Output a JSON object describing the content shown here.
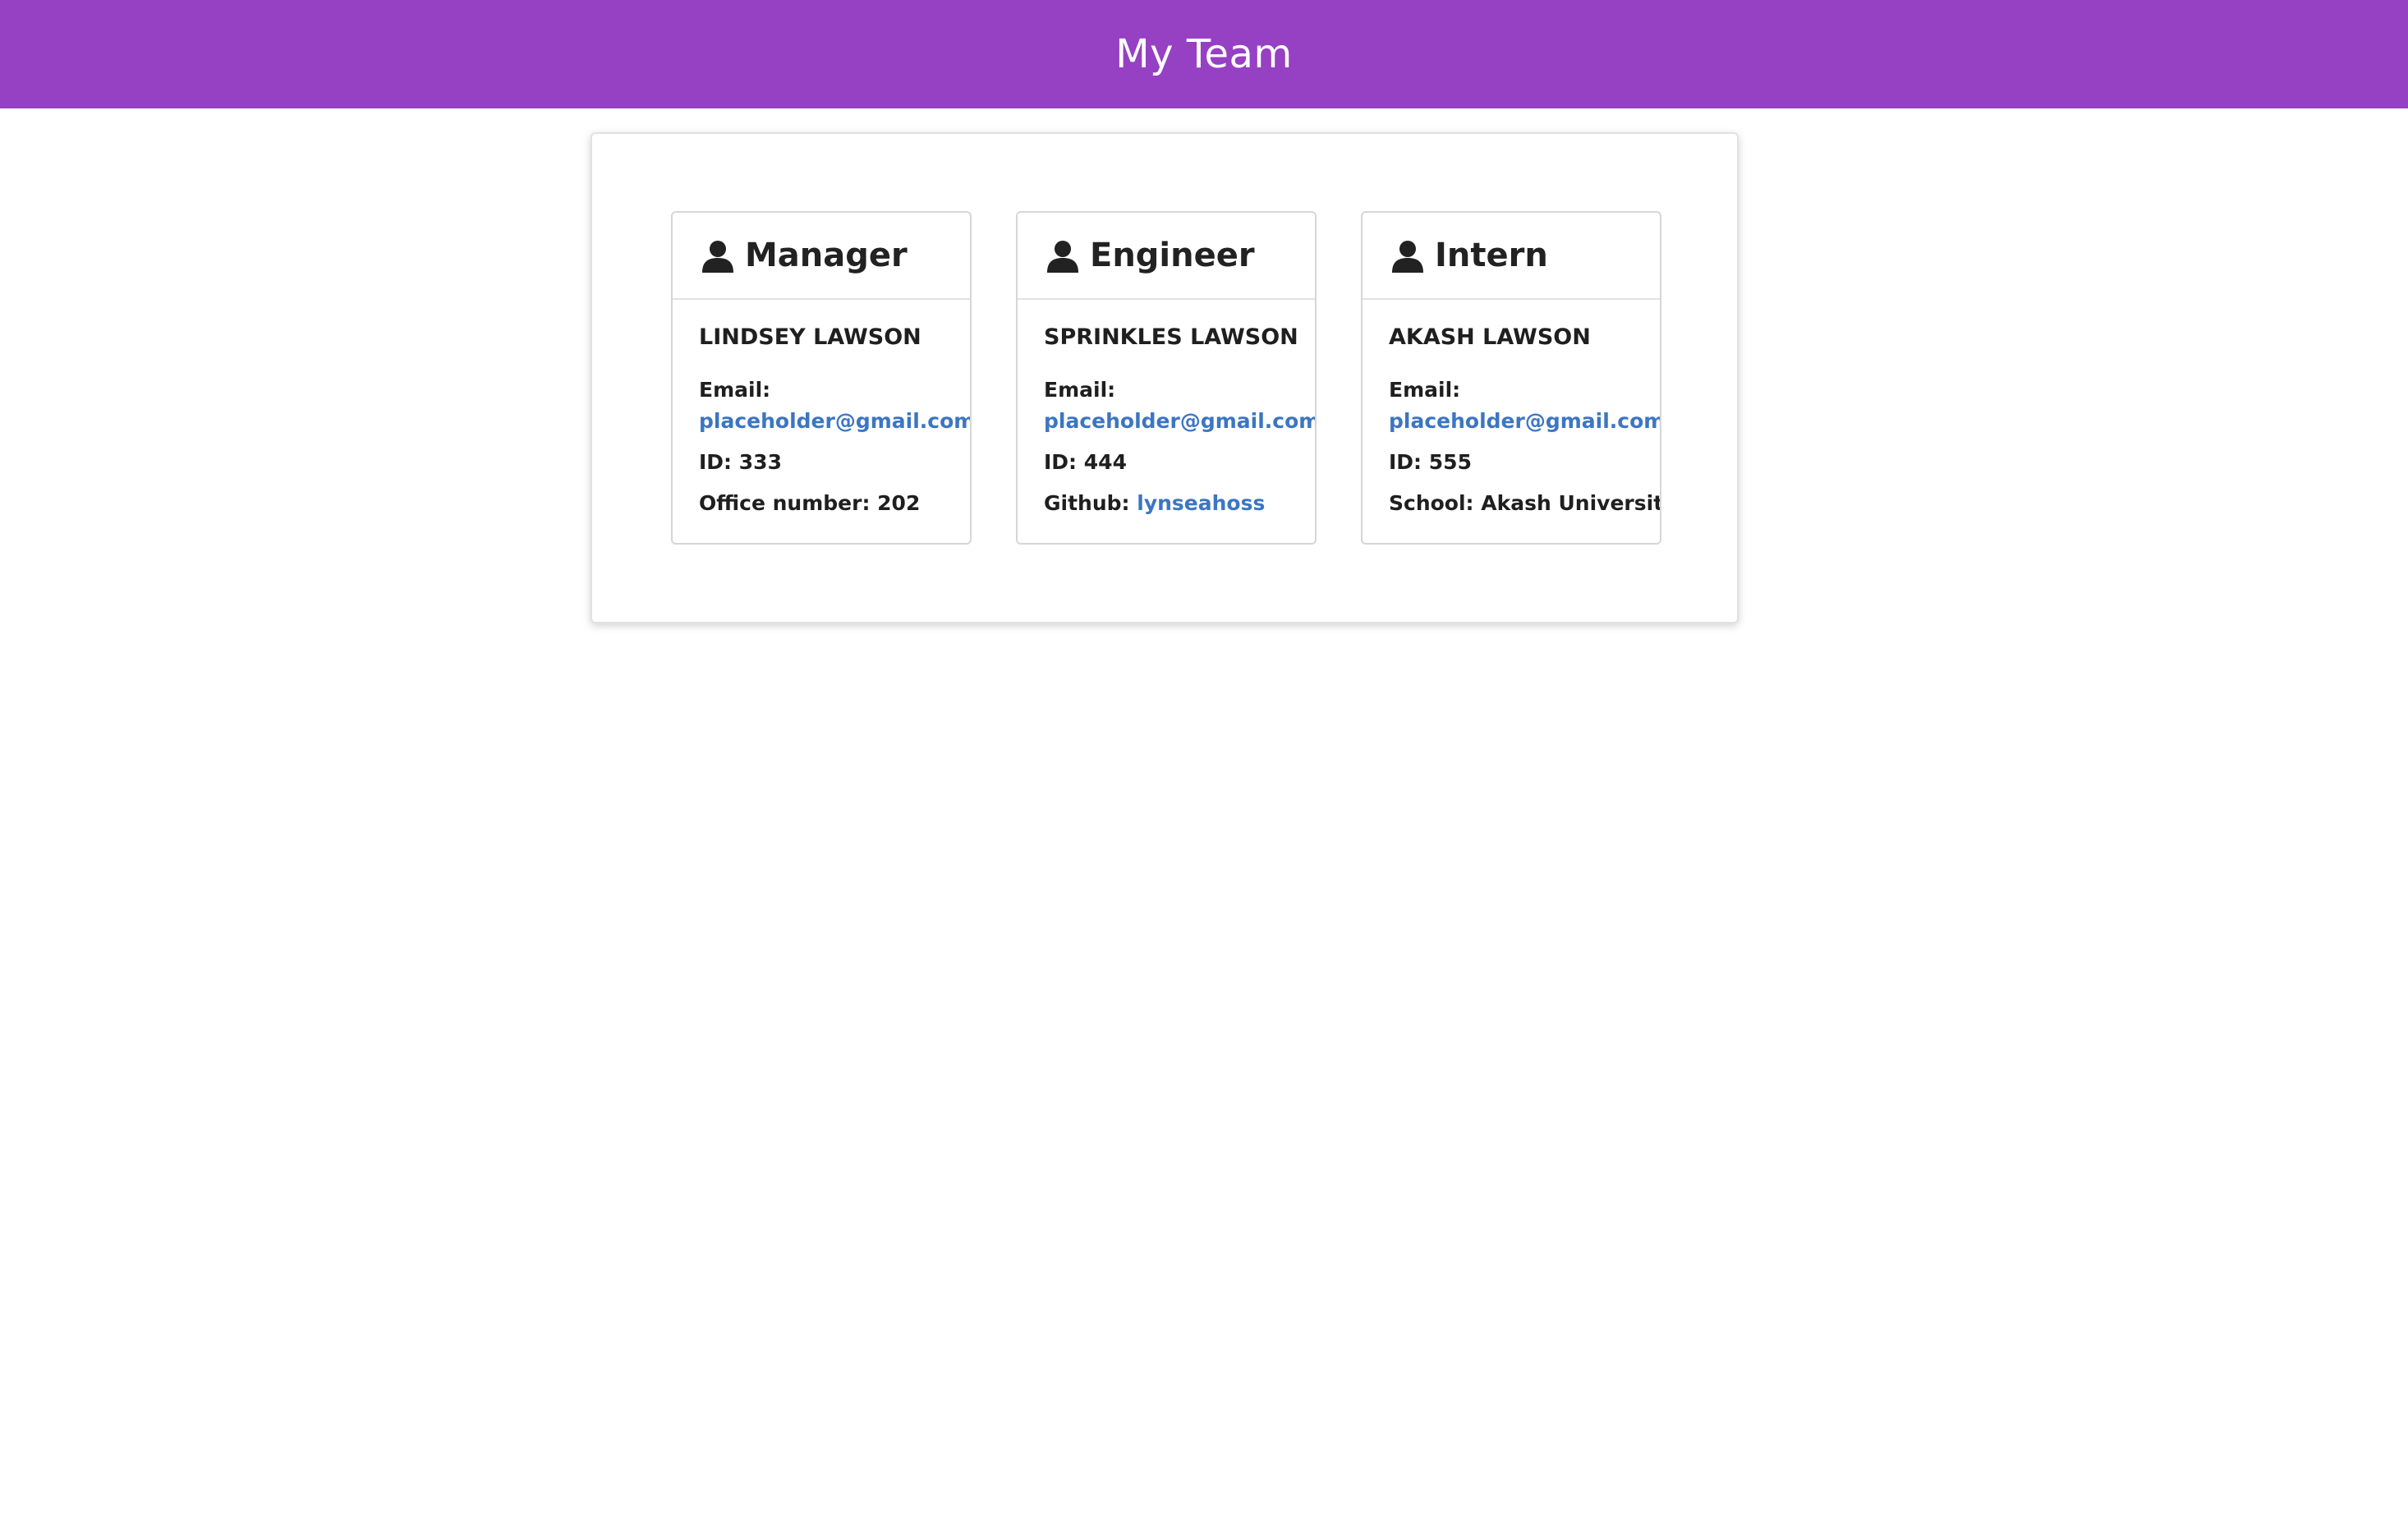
{
  "header": {
    "title": "My Team",
    "background_color": "#9640c4"
  },
  "team": [
    {
      "role": "Manager",
      "icon": "person-icon",
      "name": "LINDSEY LAWSON",
      "email_label": "Email:",
      "email": "placeholder@gmail.com",
      "id_label": "ID:",
      "id": "333",
      "extra_label": "Office number:",
      "extra_value": "202"
    },
    {
      "role": "Engineer",
      "icon": "person-icon",
      "name": "SPRINKLES LAWSON",
      "email_label": "Email:",
      "email": "placeholder@gmail.com",
      "id_label": "ID:",
      "id": "444",
      "extra_label": "Github:",
      "extra_value": "lynseahoss"
    },
    {
      "role": "Intern",
      "icon": "person-icon",
      "name": "AKASH LAWSON",
      "email_label": "Email:",
      "email": "placeholder@gmail.com",
      "id_label": "ID:",
      "id": "555",
      "extra_label": "School:",
      "extra_value": "Akash University"
    }
  ],
  "colors": {
    "link": "#3c76c2",
    "text": "#222222"
  }
}
